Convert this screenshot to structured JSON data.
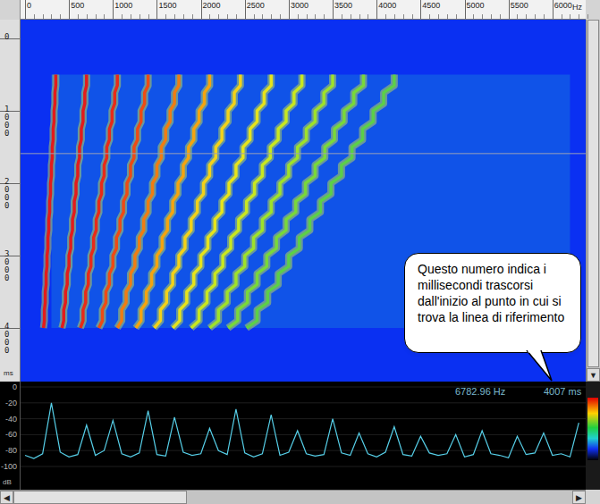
{
  "freq_axis": {
    "ticks": [
      "0",
      "500",
      "1000",
      "1500",
      "2000",
      "2500",
      "3000",
      "3500",
      "4000",
      "4500",
      "5000",
      "5500",
      "6000"
    ],
    "unit": "Hz"
  },
  "time_axis": {
    "ticks": [
      "0",
      "1000",
      "2000",
      "3000",
      "4000"
    ],
    "unit": "ms"
  },
  "spectrogram": {
    "time_ms": [
      500,
      750,
      1000,
      1250,
      1500,
      1750,
      2000,
      2250,
      2500,
      2750,
      3000,
      3250,
      3500,
      3750,
      4000
    ],
    "series": [
      {
        "hz": [
          350,
          340,
          330,
          320,
          310,
          300,
          290,
          280,
          270,
          260,
          250,
          240,
          230,
          220,
          210
        ],
        "color": "#e31b1b"
      },
      {
        "hz": [
          700,
          680,
          660,
          640,
          620,
          600,
          580,
          560,
          540,
          520,
          500,
          480,
          460,
          440,
          420
        ],
        "color": "#e31b1b"
      },
      {
        "hz": [
          1050,
          1020,
          990,
          960,
          930,
          900,
          870,
          840,
          810,
          780,
          750,
          720,
          690,
          660,
          630
        ],
        "color": "#e82a18"
      },
      {
        "hz": [
          1400,
          1360,
          1320,
          1280,
          1240,
          1200,
          1160,
          1120,
          1080,
          1040,
          1000,
          960,
          920,
          880,
          840
        ],
        "color": "#ee4a14"
      },
      {
        "hz": [
          1750,
          1700,
          1650,
          1600,
          1550,
          1500,
          1450,
          1400,
          1350,
          1300,
          1250,
          1200,
          1150,
          1100,
          1050
        ],
        "color": "#f07c12"
      },
      {
        "hz": [
          2100,
          2040,
          1980,
          1920,
          1860,
          1800,
          1740,
          1680,
          1620,
          1560,
          1500,
          1440,
          1380,
          1320,
          1260
        ],
        "color": "#f4a410"
      },
      {
        "hz": [
          2450,
          2380,
          2310,
          2240,
          2170,
          2100,
          2030,
          1960,
          1890,
          1820,
          1750,
          1680,
          1610,
          1540,
          1470
        ],
        "color": "#f2d21a"
      },
      {
        "hz": [
          2800,
          2720,
          2640,
          2560,
          2480,
          2400,
          2320,
          2240,
          2160,
          2080,
          2000,
          1920,
          1840,
          1760,
          1680
        ],
        "color": "#e6e41c"
      },
      {
        "hz": [
          3150,
          3060,
          2970,
          2880,
          2790,
          2700,
          2610,
          2520,
          2430,
          2340,
          2250,
          2160,
          2070,
          1980,
          1890
        ],
        "color": "#c8e820"
      },
      {
        "hz": [
          3500,
          3400,
          3300,
          3200,
          3100,
          3000,
          2900,
          2800,
          2700,
          2600,
          2500,
          2400,
          2300,
          2200,
          2100
        ],
        "color": "#9ee22a"
      },
      {
        "hz": [
          3850,
          3740,
          3630,
          3520,
          3410,
          3300,
          3190,
          3080,
          2970,
          2860,
          2750,
          2640,
          2530,
          2420,
          2310
        ],
        "color": "#78d83a"
      },
      {
        "hz": [
          4200,
          4080,
          3960,
          3840,
          3720,
          3600,
          3480,
          3360,
          3240,
          3120,
          3000,
          2880,
          2760,
          2640,
          2520
        ],
        "color": "#5ccf48"
      }
    ]
  },
  "reference_line": {
    "level": 0.37
  },
  "callout": {
    "text": "Questo numero indica i millisecondi trascorsi dall'inizio al punto in cui si trova la linea di riferimento"
  },
  "spectrum": {
    "readout_frequency": "6782.96 Hz",
    "readout_time": "4007 ms",
    "db_axis": {
      "ticks": [
        "0",
        "-20",
        "-40",
        "-60",
        "-80",
        "-100"
      ],
      "unit": "dB"
    },
    "bin_hz": 100,
    "values_db": [
      -86,
      -90,
      -84,
      -20,
      -82,
      -88,
      -85,
      -48,
      -86,
      -80,
      -42,
      -84,
      -88,
      -83,
      -30,
      -85,
      -87,
      -38,
      -82,
      -86,
      -84,
      -52,
      -80,
      -85,
      -28,
      -83,
      -88,
      -84,
      -35,
      -86,
      -82,
      -55,
      -84,
      -87,
      -85,
      -40,
      -83,
      -86,
      -58,
      -84,
      -88,
      -82,
      -50,
      -85,
      -87,
      -62,
      -83,
      -86,
      -84,
      -60,
      -88,
      -85,
      -55,
      -84,
      -86,
      -89,
      -62,
      -85,
      -83,
      -58,
      -86,
      -84,
      -88,
      -45
    ]
  },
  "scrollbars": {
    "vertical": {
      "down": "▼",
      "level": 0.96
    },
    "horizontal": {
      "left": "◀",
      "right": "▶",
      "level": 0.31
    }
  }
}
